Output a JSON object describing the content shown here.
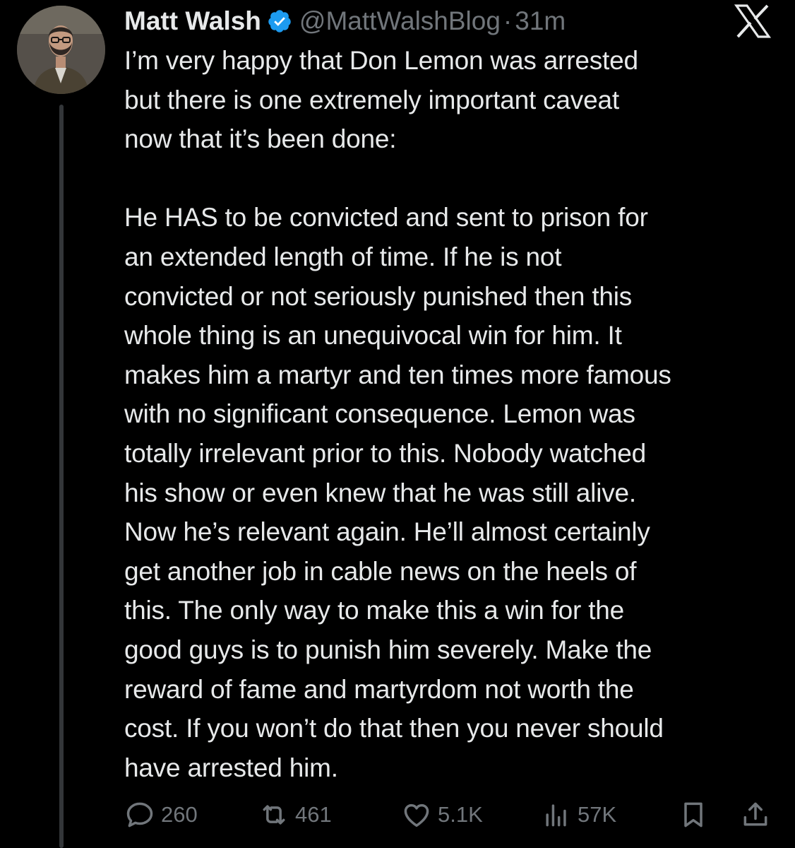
{
  "author": {
    "display_name": "Matt Walsh",
    "handle": "@MattWalshBlog",
    "separator": "·",
    "time": "31m",
    "verified": true
  },
  "colors": {
    "background": "#000000",
    "text": "#e7e9ea",
    "muted": "#71767b",
    "verified_badge": "#1d9bf0"
  },
  "icons": {
    "verified": "verified-badge-icon",
    "platform": "x-logo-icon",
    "reply": "reply-icon",
    "retweet": "retweet-icon",
    "like": "heart-icon",
    "views": "views-icon",
    "bookmark": "bookmark-icon",
    "share": "share-icon"
  },
  "tweet": {
    "text": "I’m very happy that Don Lemon was arrested\nbut there is one extremely important caveat\nnow that it’s been done:\n\nHe HAS to be convicted and sent to prison for\nan extended length of time. If he is not\nconvicted or not seriously punished then this\nwhole thing is an unequivocal win for him. It\nmakes him a martyr and ten times more famous\nwith no significant consequence. Lemon was\ntotally irrelevant prior to this. Nobody watched\nhis show or even knew that he was still alive.\nNow he’s relevant again. He’ll almost certainly\nget another job in cable news on the heels of\nthis. The only way to make this a win for the\ngood guys is to punish him severely. Make the\nreward of fame and martyrdom not worth the\ncost. If you won’t do that then you never should\nhave arrested him."
  },
  "actions": {
    "replies": "260",
    "retweets": "461",
    "likes": "5.1K",
    "views": "57K"
  }
}
